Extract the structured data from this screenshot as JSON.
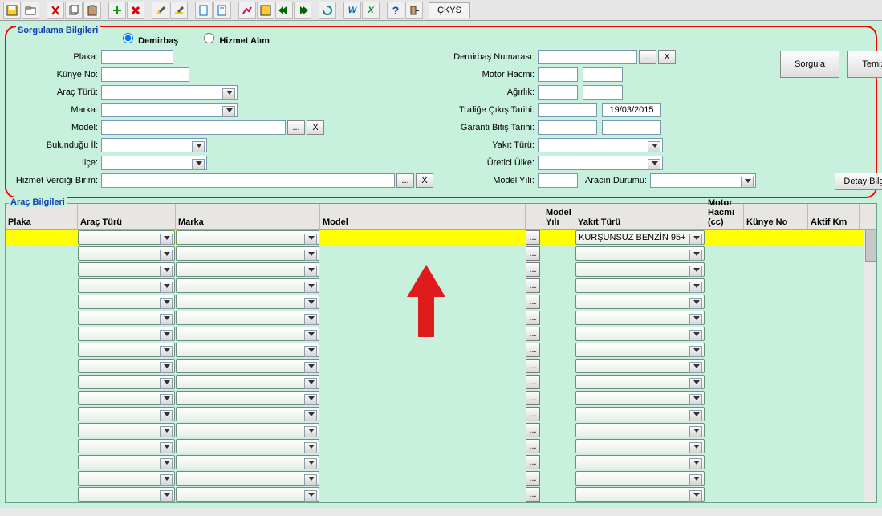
{
  "toolbar": {
    "ckys_label": "ÇKYS"
  },
  "panel": {
    "title": "Sorgulama Bilgileri",
    "radio_demirbas": "Demirbaş",
    "radio_hizmet": "Hizmet Alım",
    "labels": {
      "plaka": "Plaka:",
      "kunye": "Künye No:",
      "arac_turu": "Araç Türü:",
      "marka": "Marka:",
      "model": "Model:",
      "bulundugu_il": "Bulunduğu İl:",
      "ilce": "İlçe:",
      "hizmet_birim": "Hizmet Verdiği Birim:",
      "demirbas_no": "Demirbaş Numarası:",
      "motor_hacmi": "Motor Hacmi:",
      "agirlik": "Ağırlık:",
      "trafige_cikis": "Trafiğe Çıkış Tarihi:",
      "garanti_bitis": "Garanti Bitiş Tarihi:",
      "yakit_turu": "Yakıt Türü:",
      "uretici_ulke": "Üretici Ülke:",
      "model_yili": "Model Yılı:",
      "aracin_durumu": "Aracın Durumu:"
    },
    "values": {
      "trafige_cikis": "19/03/2015"
    },
    "buttons": {
      "dots": "...",
      "x": "X",
      "sorgula": "Sorgula",
      "temizle": "Temizle",
      "detay": "Detay Bilgileri"
    }
  },
  "grid": {
    "title": "Araç Bilgileri",
    "headers": {
      "plaka": "Plaka",
      "arac_turu": "Araç Türü",
      "marka": "Marka",
      "model": "Model",
      "model_yili": "Model Yılı",
      "yakit_turu": "Yakıt Türü",
      "motor_hacmi": "Motor Hacmi (cc)",
      "kunye": "Künye No",
      "aktif_km": "Aktif Km"
    },
    "selected_row": {
      "yakit_turu": "KURŞUNSUZ BENZİN 95+"
    },
    "row_count": 17
  }
}
